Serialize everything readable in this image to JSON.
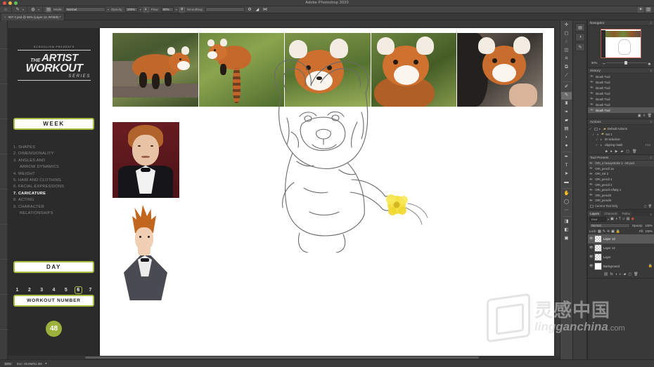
{
  "window": {
    "app_title": "Adobe Photoshop 2020",
    "traffic_lights": [
      "close",
      "minimize",
      "zoom"
    ]
  },
  "options_bar": {
    "tool_icon": "brush-tool-icon",
    "brush_preset_label": "",
    "size_label": "",
    "mode_label": "Mode:",
    "mode_value": "Normal",
    "opacity_label": "Opacity:",
    "opacity_value": "100%",
    "pressure_opacity_icon": "pressure-opacity-icon",
    "flow_label": "Flow:",
    "flow_value": "90%",
    "airbrush_icon": "airbrush-icon",
    "smoothing_label": "Smoothing:",
    "smoothing_value": "",
    "smoothing_settings_icon": "gear-icon",
    "angle_icon": "brush-angle-icon",
    "symmetry_icon": "symmetry-icon",
    "tablet_pressure_icon": "tablet-pressure-icon",
    "eraser_icon": "eraser-toggle-icon"
  },
  "document_tab": {
    "label": "#07-7.psd @ 50% (Layer 13, RGB/8) *",
    "close_icon": "close-icon"
  },
  "course_panel": {
    "presents": "SCHOOLISM PRESENTS",
    "logo_the": "THE",
    "logo_artist": "ARTIST",
    "logo_workout": "WORKOUT",
    "logo_series": "SERIES",
    "week_label": "WEEK",
    "topics": [
      {
        "num": "1.",
        "label": "SHAPES",
        "active": false
      },
      {
        "num": "2.",
        "label": "DIMENSIONALITY",
        "active": false
      },
      {
        "num": "3.",
        "label": "ANGLES AND",
        "active": false
      },
      {
        "num": "",
        "label": "ARROW DYNAMICS",
        "active": false
      },
      {
        "num": "4.",
        "label": "WEIGHT",
        "active": false
      },
      {
        "num": "5.",
        "label": "HAIR AND CLOTHING",
        "active": false
      },
      {
        "num": "6.",
        "label": "FACIAL EXPRESSIONS",
        "active": false
      },
      {
        "num": "7.",
        "label": "CARICATURE",
        "active": true
      },
      {
        "num": "8.",
        "label": "ACTING",
        "active": false
      },
      {
        "num": "9.",
        "label": "CHARACTER",
        "active": false
      },
      {
        "num": "",
        "label": "RELATIONSHIPS",
        "active": false
      }
    ],
    "day_label": "DAY",
    "days": [
      "1",
      "2",
      "3",
      "4",
      "5",
      "6",
      "7"
    ],
    "selected_day": "6",
    "workout_number_label": "WORKOUT NUMBER",
    "workout_number": "48",
    "accent_color": "#aabb44",
    "circle_color": "#9cb03c"
  },
  "canvas": {
    "reference_photos": [
      "red-panda-on-log",
      "red-panda-climbing-branch",
      "red-panda-face-closeup",
      "red-panda-portrait",
      "red-panda-held-closeup"
    ],
    "reference_portrait": "conan-obrien-photo",
    "caricature_sketch": "conan-caricature-color",
    "main_sketch": "red-panda-caricature-line-drawing"
  },
  "tools_palette": {
    "tools": [
      "move-tool",
      "rectangular-marquee-tool",
      "lasso-tool",
      "object-selection-tool",
      "crop-tool",
      "frame-tool",
      "eyedropper-tool",
      "spot-healing-brush-tool",
      "brush-tool",
      "clone-stamp-tool",
      "history-brush-tool",
      "eraser-tool",
      "gradient-tool",
      "blur-tool",
      "dodge-tool",
      "pen-tool",
      "type-tool",
      "path-selection-tool",
      "shape-tool",
      "hand-tool",
      "zoom-tool",
      "edit-toolbar",
      "foreground-background-color",
      "quick-mask-mode",
      "screen-mode"
    ],
    "active_tool": "brush-tool"
  },
  "navigator": {
    "title": "Navigator",
    "menu_icon": "panel-menu-icon",
    "zoom_value": "50%",
    "zoom_out_icon": "zoom-out-icon",
    "zoom_in_icon": "zoom-in-icon"
  },
  "history": {
    "title": "History",
    "menu_icon": "panel-menu-icon",
    "entries": [
      {
        "label": "Brush Tool",
        "selected": false
      },
      {
        "label": "Brush Tool",
        "selected": false
      },
      {
        "label": "Brush Tool",
        "selected": false
      },
      {
        "label": "Brush Tool",
        "selected": false
      },
      {
        "label": "Brush Tool",
        "selected": false
      },
      {
        "label": "Brush Tool",
        "selected": false
      },
      {
        "label": "Brush Tool",
        "selected": true
      }
    ],
    "footer_icons": [
      "create-document-icon",
      "create-snapshot-icon",
      "delete-icon"
    ]
  },
  "actions": {
    "title": "Actions",
    "menu_icon": "panel-menu-icon",
    "rows": [
      {
        "label": "Default Actions",
        "indent": 0,
        "type": "folder",
        "key": ""
      },
      {
        "label": "Set 1",
        "indent": 1,
        "type": "folder",
        "key": ""
      },
      {
        "label": "ID selection",
        "indent": 2,
        "type": "action",
        "key": ""
      },
      {
        "label": "clipping mask",
        "indent": 2,
        "type": "action",
        "key": "F10"
      }
    ],
    "footer_icons": [
      "stop-icon",
      "record-icon",
      "play-icon",
      "new-set-icon",
      "new-action-icon",
      "delete-icon"
    ]
  },
  "tool_presets": {
    "title": "Tool Presets",
    "menu_icon": "panel-menu-icon",
    "items": [
      "ORI_a heavystroke 2 - 60 pxd",
      "ORI_pencil 1a",
      "ORI_mk 2",
      "ORI_pencil 4",
      "ORI_pencil 2",
      "ORI_pencil A/fatty 1",
      "ORI_pencil3",
      "ORI_pencil4"
    ],
    "current_tool_only_label": "Current Tool Only"
  },
  "layers": {
    "tabs": [
      {
        "label": "Layers",
        "active": true
      },
      {
        "label": "Channels",
        "active": false
      },
      {
        "label": "Paths",
        "active": false
      }
    ],
    "menu_icon": "panel-menu-icon",
    "filter_label": "Kind",
    "filter_icons": [
      "pixel-filter-icon",
      "adjustment-filter-icon",
      "type-filter-icon",
      "shape-filter-icon",
      "smart-object-filter-icon"
    ],
    "blend_mode": "Normal",
    "opacity_label": "Opacity:",
    "opacity_value": "100%",
    "lock_label": "Lock:",
    "lock_icons": [
      "lock-transparency-icon",
      "lock-image-icon",
      "lock-position-icon",
      "lock-artboard-icon",
      "lock-all-icon"
    ],
    "fill_label": "Fill:",
    "fill_value": "100%",
    "items": [
      {
        "name": "Layer 13",
        "visible": true,
        "selected": true
      },
      {
        "name": "Layer 12",
        "visible": true,
        "selected": false
      },
      {
        "name": "Layer",
        "visible": true,
        "selected": false
      },
      {
        "name": "Background",
        "visible": true,
        "selected": false
      }
    ],
    "footer_icons": [
      "link-layers-icon",
      "layer-style-icon",
      "layer-mask-icon",
      "adjustment-layer-icon",
      "new-group-icon",
      "new-layer-icon",
      "delete-layer-icon"
    ]
  },
  "status_bar": {
    "zoom": "50%",
    "doc_size": "Doc: 25.9M/61.5M",
    "arrow_icon": "status-arrow-icon"
  },
  "watermark": {
    "chinese": "灵感中国",
    "latin": "lingganchina",
    "domain": ".com"
  }
}
